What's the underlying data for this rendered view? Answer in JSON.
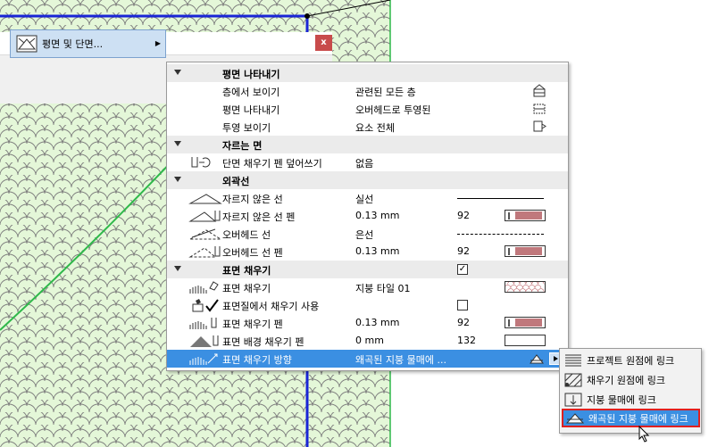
{
  "colors": {
    "canvas_bg": "#e4f7d8",
    "tile_stroke": "#7c7c7c",
    "blue_line": "#1a25d6",
    "green_line": "#2fb84a",
    "selection": "#3b8fe2",
    "highlight_border": "#e02020",
    "pen_swatch": "#c0787c"
  },
  "dialog": {
    "close_label": "x",
    "menu_item_label": "평면 및 단면..."
  },
  "panel": {
    "sections": {
      "plan_display": {
        "title": "평면 나타내기",
        "rows": [
          {
            "name": "층에서 보이기",
            "value": "관련된 모든 층",
            "icon": "floors-icon"
          },
          {
            "name": "평면 나타내기",
            "value": "오버헤드로 투영된",
            "icon": "projection-icon"
          },
          {
            "name": "투영 보이기",
            "value": "요소 전체",
            "icon": "show-projection-icon"
          }
        ]
      },
      "cut_surfaces": {
        "title": "자르는 면",
        "rows": [
          {
            "name": "단면 채우기 펜 덮어쓰기",
            "value": "없음",
            "icon": "cut-fill-pen-icon"
          }
        ]
      },
      "outlines": {
        "title": "외곽선",
        "rows": [
          {
            "name": "자르지 않은 선",
            "value": "실선",
            "icon": "uncut-line-icon"
          },
          {
            "name": "자르지 않은 선 펜",
            "value": "0.13 mm",
            "pen": "92",
            "icon": "uncut-pen-icon"
          },
          {
            "name": "오버헤드 선",
            "value": "은선",
            "icon": "overhead-line-icon"
          },
          {
            "name": "오버헤드 선  펜",
            "value": "0.13 mm",
            "pen": "92",
            "icon": "overhead-pen-icon"
          }
        ]
      },
      "cover_fills": {
        "title": "표면 채우기",
        "checked_mark": "✓",
        "rows": [
          {
            "name": "표면 채우기",
            "value": "지붕 타일 01",
            "icon": "cover-fill-icon"
          },
          {
            "name": "표면질에서 채우기 사용",
            "value": "",
            "icon": "surface-fill-icon"
          },
          {
            "name": "표면 채우기 펜",
            "value": "0.13 mm",
            "pen": "92",
            "icon": "cover-fill-pen-icon"
          },
          {
            "name": "표면 배경 채우기 펜",
            "value": "0 mm",
            "pen": "132",
            "icon": "background-pen-icon"
          },
          {
            "name": "표면 채우기 방향",
            "value": "왜곡된 지붕 물매에 ...",
            "icon": "fill-orientation-icon"
          }
        ]
      }
    }
  },
  "submenu": {
    "items": [
      {
        "label": "프로젝트 원점에 링크",
        "icon": "project-origin-icon"
      },
      {
        "label": "채우기 원점에 링크",
        "icon": "fill-origin-icon"
      },
      {
        "label": "지붕 물매에 링크",
        "icon": "roof-pitch-icon"
      },
      {
        "label": "왜곡된 지붕 물매에 링크",
        "icon": "distorted-roof-pitch-icon"
      }
    ]
  }
}
